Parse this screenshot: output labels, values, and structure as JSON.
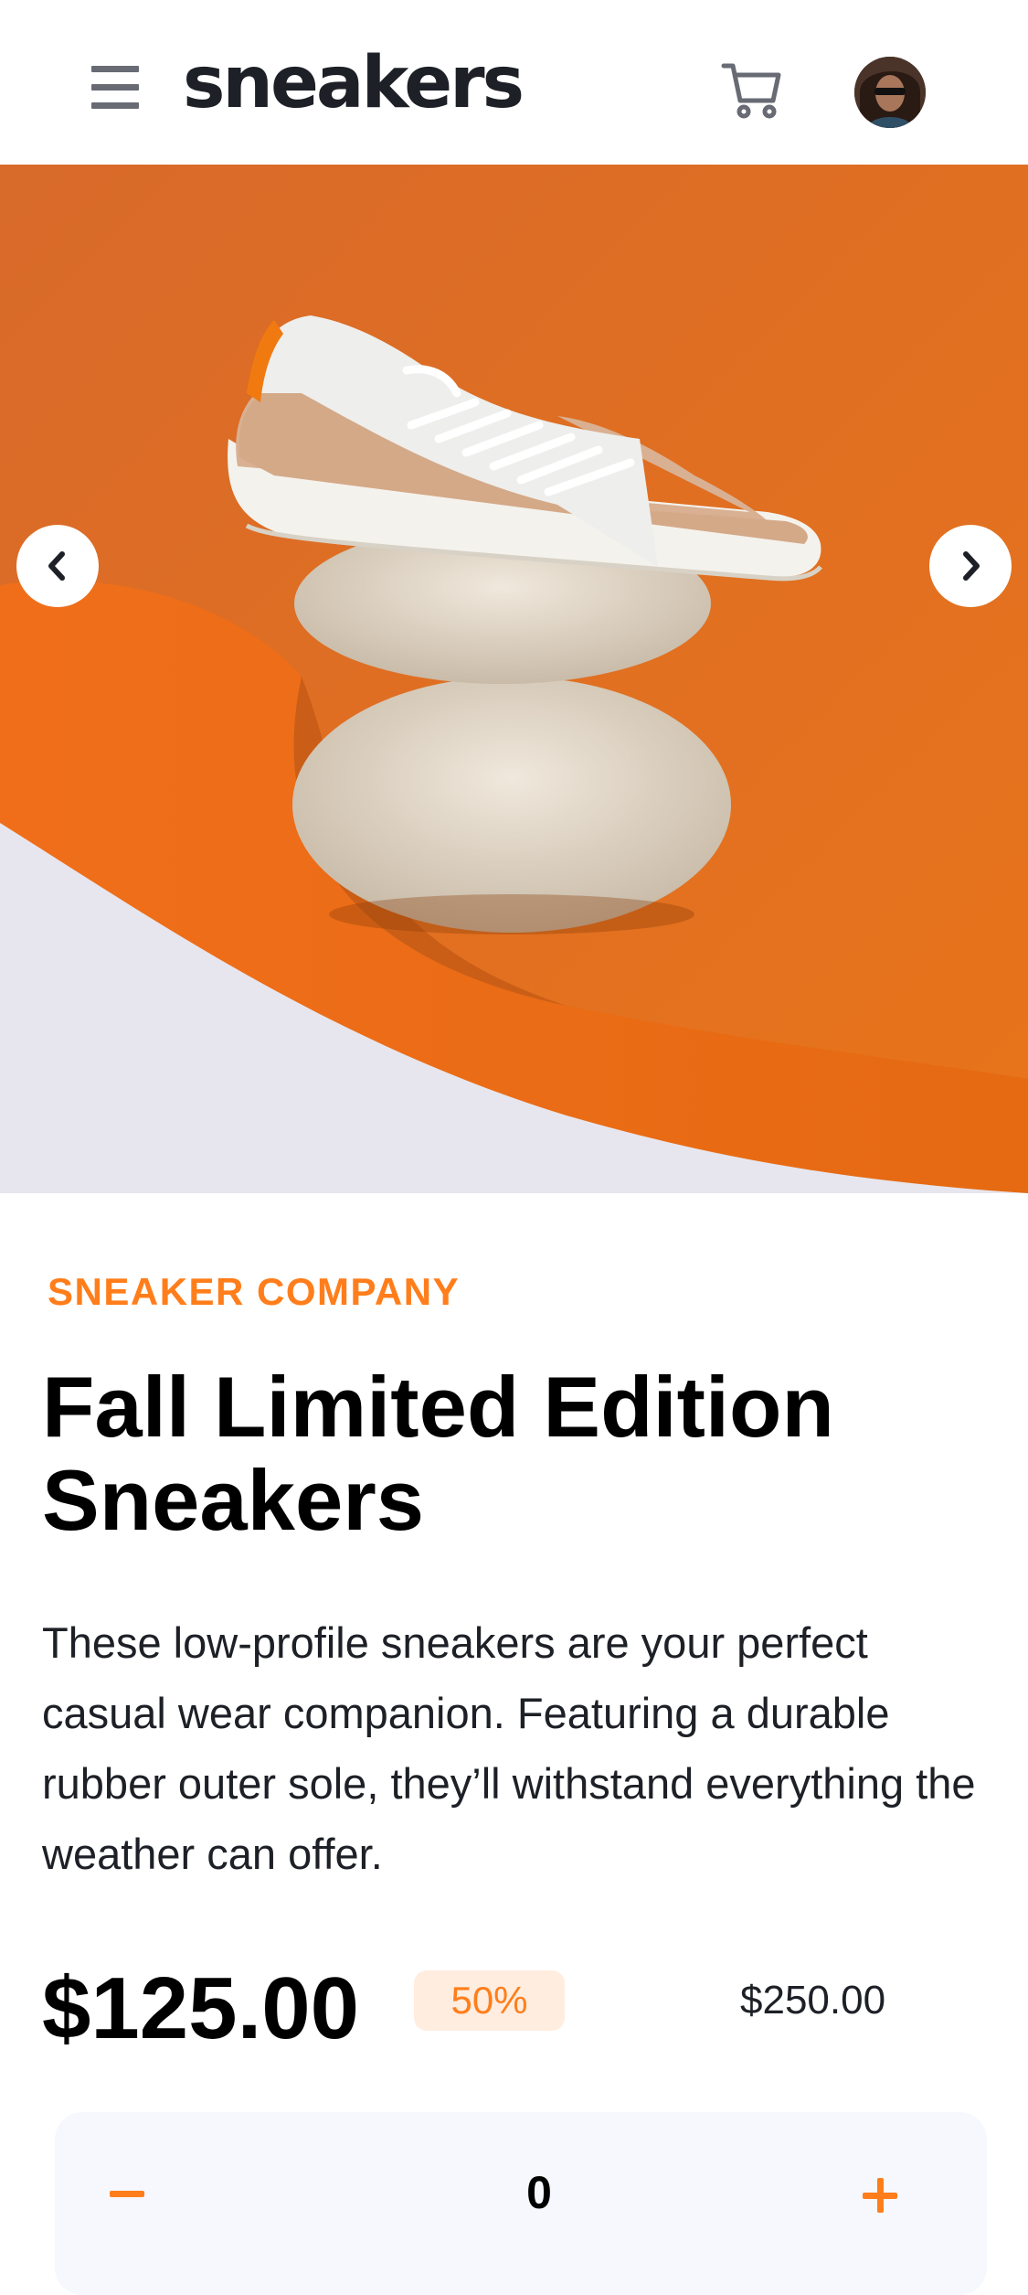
{
  "header": {
    "logo": "sneakers",
    "icons": [
      "menu-icon",
      "cart-icon",
      "avatar"
    ]
  },
  "gallery": {
    "prev_icon": "chevron-left-icon",
    "next_icon": "chevron-right-icon"
  },
  "product": {
    "company": "SNEAKER COMPANY",
    "title": "Fall Limited Edition Sneakers",
    "description": "These low-profile sneakers are your perfect casual wear companion. Featuring a durable rubber outer sole, they’ll withstand everything the weather can offer.",
    "price": "$125.00",
    "discount": "50%",
    "original_price": "$250.00"
  },
  "quantity": {
    "value": "0",
    "minus_icon": "minus-icon",
    "plus_icon": "plus-icon"
  },
  "colors": {
    "accent": "#ff7e1b",
    "accent_pale": "#ffede0",
    "dark_text": "#1d2026",
    "muted_icon": "#686b74",
    "panel_bg": "#f6f8fd"
  }
}
